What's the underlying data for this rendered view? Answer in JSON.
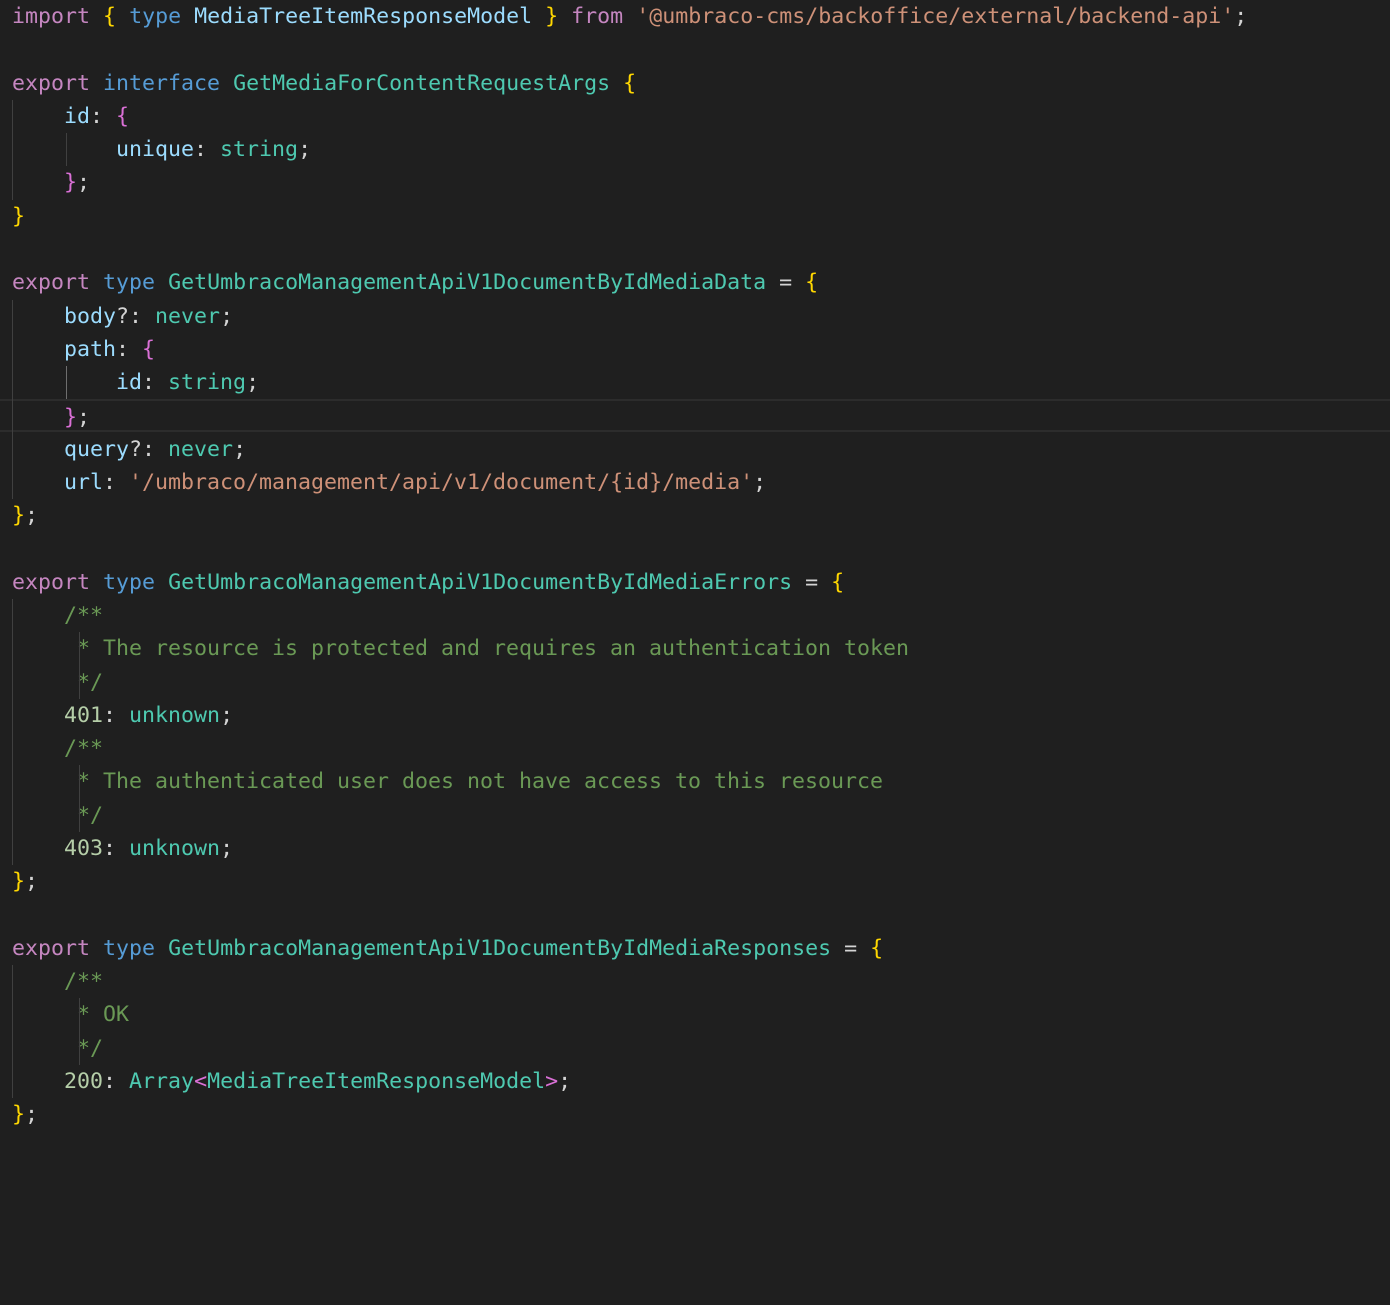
{
  "editor": {
    "language": "typescript",
    "theme_background": "#1f1f1f",
    "active_line": 13,
    "lines": [
      [
        [
          "kw",
          "import"
        ],
        [
          "pu",
          " "
        ],
        [
          "b1",
          "{"
        ],
        [
          "pu",
          " "
        ],
        [
          "kt",
          "type"
        ],
        [
          "pu",
          " "
        ],
        [
          "pr",
          "MediaTreeItemResponseModel"
        ],
        [
          "pu",
          " "
        ],
        [
          "b1",
          "}"
        ],
        [
          "pu",
          " "
        ],
        [
          "kw",
          "from"
        ],
        [
          "pu",
          " "
        ],
        [
          "st",
          "'@umbraco-cms/backoffice/external/backend-api'"
        ],
        [
          "pu",
          ";"
        ]
      ],
      [],
      [
        [
          "kw",
          "export"
        ],
        [
          "pu",
          " "
        ],
        [
          "kt",
          "interface"
        ],
        [
          "pu",
          " "
        ],
        [
          "ty",
          "GetMediaForContentRequestArgs"
        ],
        [
          "pu",
          " "
        ],
        [
          "b1",
          "{"
        ]
      ],
      [
        [
          "pu",
          "    "
        ],
        [
          "pr",
          "id"
        ],
        [
          "pu",
          ": "
        ],
        [
          "b2",
          "{"
        ]
      ],
      [
        [
          "pu",
          "        "
        ],
        [
          "pr",
          "unique"
        ],
        [
          "pu",
          ": "
        ],
        [
          "ty",
          "string"
        ],
        [
          "pu",
          ";"
        ]
      ],
      [
        [
          "pu",
          "    "
        ],
        [
          "b2",
          "}"
        ],
        [
          "pu",
          ";"
        ]
      ],
      [
        [
          "b1",
          "}"
        ]
      ],
      [],
      [
        [
          "kw",
          "export"
        ],
        [
          "pu",
          " "
        ],
        [
          "kt",
          "type"
        ],
        [
          "pu",
          " "
        ],
        [
          "ty",
          "GetUmbracoManagementApiV1DocumentByIdMediaData"
        ],
        [
          "pu",
          " = "
        ],
        [
          "b1",
          "{"
        ]
      ],
      [
        [
          "pu",
          "    "
        ],
        [
          "pr",
          "body"
        ],
        [
          "pu",
          "?: "
        ],
        [
          "ty",
          "never"
        ],
        [
          "pu",
          ";"
        ]
      ],
      [
        [
          "pu",
          "    "
        ],
        [
          "pr",
          "path"
        ],
        [
          "pu",
          ": "
        ],
        [
          "b2",
          "{"
        ]
      ],
      [
        [
          "pu",
          "        "
        ],
        [
          "pr",
          "id"
        ],
        [
          "pu",
          ": "
        ],
        [
          "ty",
          "string"
        ],
        [
          "pu",
          ";"
        ]
      ],
      [
        [
          "pu",
          "    "
        ],
        [
          "b2",
          "}"
        ],
        [
          "pu",
          ";"
        ]
      ],
      [
        [
          "pu",
          "    "
        ],
        [
          "pr",
          "query"
        ],
        [
          "pu",
          "?: "
        ],
        [
          "ty",
          "never"
        ],
        [
          "pu",
          ";"
        ]
      ],
      [
        [
          "pu",
          "    "
        ],
        [
          "pr",
          "url"
        ],
        [
          "pu",
          ": "
        ],
        [
          "st",
          "'/umbraco/management/api/v1/document/{id}/media'"
        ],
        [
          "pu",
          ";"
        ]
      ],
      [
        [
          "b1",
          "}"
        ],
        [
          "pu",
          ";"
        ]
      ],
      [],
      [
        [
          "kw",
          "export"
        ],
        [
          "pu",
          " "
        ],
        [
          "kt",
          "type"
        ],
        [
          "pu",
          " "
        ],
        [
          "ty",
          "GetUmbracoManagementApiV1DocumentByIdMediaErrors"
        ],
        [
          "pu",
          " = "
        ],
        [
          "b1",
          "{"
        ]
      ],
      [
        [
          "pu",
          "    "
        ],
        [
          "cm",
          "/**"
        ]
      ],
      [
        [
          "pu",
          "    "
        ],
        [
          "cm",
          " * The resource is protected and requires an authentication token"
        ]
      ],
      [
        [
          "pu",
          "    "
        ],
        [
          "cm",
          " */"
        ]
      ],
      [
        [
          "pu",
          "    "
        ],
        [
          "nu",
          "401"
        ],
        [
          "pu",
          ": "
        ],
        [
          "ty",
          "unknown"
        ],
        [
          "pu",
          ";"
        ]
      ],
      [
        [
          "pu",
          "    "
        ],
        [
          "cm",
          "/**"
        ]
      ],
      [
        [
          "pu",
          "    "
        ],
        [
          "cm",
          " * The authenticated user does not have access to this resource"
        ]
      ],
      [
        [
          "pu",
          "    "
        ],
        [
          "cm",
          " */"
        ]
      ],
      [
        [
          "pu",
          "    "
        ],
        [
          "nu",
          "403"
        ],
        [
          "pu",
          ": "
        ],
        [
          "ty",
          "unknown"
        ],
        [
          "pu",
          ";"
        ]
      ],
      [
        [
          "b1",
          "}"
        ],
        [
          "pu",
          ";"
        ]
      ],
      [],
      [
        [
          "kw",
          "export"
        ],
        [
          "pu",
          " "
        ],
        [
          "kt",
          "type"
        ],
        [
          "pu",
          " "
        ],
        [
          "ty",
          "GetUmbracoManagementApiV1DocumentByIdMediaResponses"
        ],
        [
          "pu",
          " = "
        ],
        [
          "b1",
          "{"
        ]
      ],
      [
        [
          "pu",
          "    "
        ],
        [
          "cm",
          "/**"
        ]
      ],
      [
        [
          "pu",
          "    "
        ],
        [
          "cm",
          " * OK"
        ]
      ],
      [
        [
          "pu",
          "    "
        ],
        [
          "cm",
          " */"
        ]
      ],
      [
        [
          "pu",
          "    "
        ],
        [
          "nu",
          "200"
        ],
        [
          "pu",
          ": "
        ],
        [
          "ty",
          "Array"
        ],
        [
          "b2",
          "<"
        ],
        [
          "ty",
          "MediaTreeItemResponseModel"
        ],
        [
          "b2",
          ">"
        ],
        [
          "pu",
          ";"
        ]
      ],
      [
        [
          "b1",
          "}"
        ],
        [
          "pu",
          ";"
        ]
      ]
    ]
  }
}
